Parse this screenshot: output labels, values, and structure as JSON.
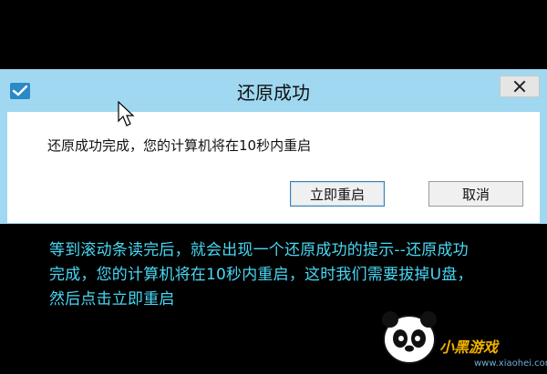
{
  "dialog": {
    "title": "还原成功",
    "message": "还原成功完成，您的计算机将在10秒内重启",
    "restart_button": "立即重启",
    "cancel_button": "取消"
  },
  "caption": {
    "text": "等到滚动条读完后，就会出现一个还原成功的提示--还原成功完成，您的计算机将在10秒内重启，这时我们需要拔掉U盘，然后点击立即重启"
  },
  "watermark": {
    "logo_text": "小黑游戏",
    "url": "www.xiaohei.com"
  }
}
